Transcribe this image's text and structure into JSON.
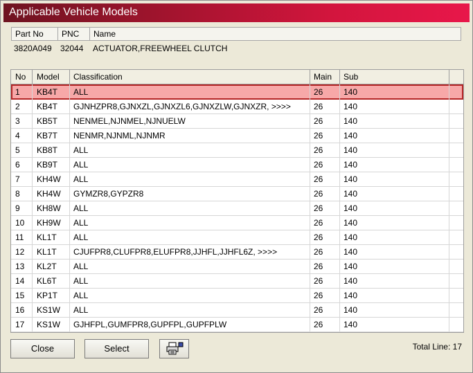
{
  "window": {
    "title": "Applicable Vehicle Models"
  },
  "part_info": {
    "headers": {
      "part_no": "Part No",
      "pnc": "PNC",
      "name": "Name"
    },
    "values": {
      "part_no": "3820A049",
      "pnc": "32044",
      "name": "ACTUATOR,FREEWHEEL CLUTCH"
    }
  },
  "grid": {
    "headers": {
      "no": "No",
      "model": "Model",
      "classification": "Classification",
      "main": "Main",
      "sub": "Sub"
    },
    "rows": [
      {
        "no": "1",
        "model": "KB4T",
        "classification": "ALL",
        "main": "26",
        "sub": "140"
      },
      {
        "no": "2",
        "model": "KB4T",
        "classification": "GJNHZPR8,GJNXZL,GJNXZL6,GJNXZLW,GJNXZR,  >>>>",
        "main": "26",
        "sub": "140"
      },
      {
        "no": "3",
        "model": "KB5T",
        "classification": "NENMEL,NJNMEL,NJNUELW",
        "main": "26",
        "sub": "140"
      },
      {
        "no": "4",
        "model": "KB7T",
        "classification": "NENMR,NJNML,NJNMR",
        "main": "26",
        "sub": "140"
      },
      {
        "no": "5",
        "model": "KB8T",
        "classification": "ALL",
        "main": "26",
        "sub": "140"
      },
      {
        "no": "6",
        "model": "KB9T",
        "classification": "ALL",
        "main": "26",
        "sub": "140"
      },
      {
        "no": "7",
        "model": "KH4W",
        "classification": "ALL",
        "main": "26",
        "sub": "140"
      },
      {
        "no": "8",
        "model": "KH4W",
        "classification": "GYMZR8,GYPZR8",
        "main": "26",
        "sub": "140"
      },
      {
        "no": "9",
        "model": "KH8W",
        "classification": "ALL",
        "main": "26",
        "sub": "140"
      },
      {
        "no": "10",
        "model": "KH9W",
        "classification": "ALL",
        "main": "26",
        "sub": "140"
      },
      {
        "no": "11",
        "model": "KL1T",
        "classification": "ALL",
        "main": "26",
        "sub": "140"
      },
      {
        "no": "12",
        "model": "KL1T",
        "classification": "CJUFPR8,CLUFPR8,ELUFPR8,JJHFL,JJHFL6Z,  >>>>",
        "main": "26",
        "sub": "140"
      },
      {
        "no": "13",
        "model": "KL2T",
        "classification": "ALL",
        "main": "26",
        "sub": "140"
      },
      {
        "no": "14",
        "model": "KL6T",
        "classification": "ALL",
        "main": "26",
        "sub": "140"
      },
      {
        "no": "15",
        "model": "KP1T",
        "classification": "ALL",
        "main": "26",
        "sub": "140"
      },
      {
        "no": "16",
        "model": "KS1W",
        "classification": "ALL",
        "main": "26",
        "sub": "140"
      },
      {
        "no": "17",
        "model": "KS1W",
        "classification": "GJHFPL,GUMFPR8,GUPFPL,GUPFPLW",
        "main": "26",
        "sub": "140"
      }
    ],
    "selected_row": 1
  },
  "footer": {
    "close_label": "Close",
    "select_label": "Select",
    "print_icon": "printer-icon",
    "total_line": "Total Line: 17"
  },
  "colors": {
    "selection_fill": "#f7a8a8",
    "selection_border": "#b42626",
    "title_gradient_start": "#6e1320",
    "title_gradient_end": "#e8174a"
  }
}
